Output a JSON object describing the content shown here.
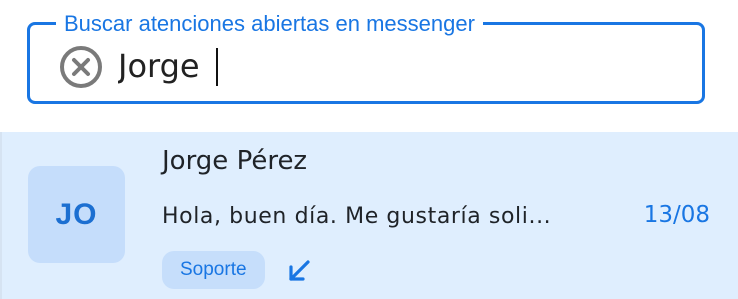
{
  "search": {
    "label": "Buscar atenciones abiertas en messenger",
    "value": "Jorge",
    "clear_icon": "clear-circle-icon"
  },
  "results": [
    {
      "avatar_initials": "JO",
      "name": "Jorge Pérez",
      "preview": "Hola, buen día. Me gustaría soli...",
      "date": "13/08",
      "tag": "Soporte",
      "direction_icon": "arrow-down-left-icon"
    }
  ],
  "colors": {
    "accent": "#1976e3",
    "item_background": "#dfeefe",
    "avatar_background": "#c5ddfb",
    "tag_background": "#c6defb",
    "clear_icon": "#7a7a7a"
  }
}
